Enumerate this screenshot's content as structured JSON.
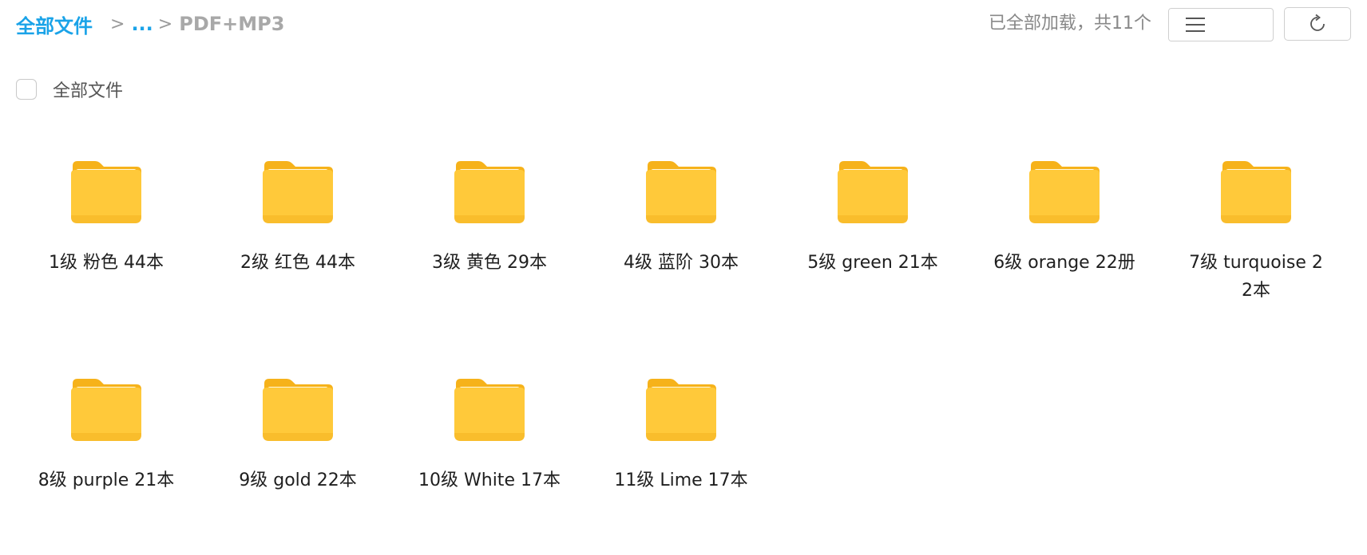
{
  "breadcrumb": {
    "root": "全部文件",
    "sep": ">",
    "ellipsis": "...",
    "current": "PDF+MP3"
  },
  "status": {
    "text": "已全部加载，共11个"
  },
  "toolbar": {
    "list_view_icon": "list-icon",
    "grid_view_icon": "grid-icon",
    "refresh_icon": "refresh-icon",
    "active_view": "grid"
  },
  "select_all": {
    "label": "全部文件"
  },
  "folders": [
    {
      "name": "1级 粉色 44本"
    },
    {
      "name": "2级 红色 44本"
    },
    {
      "name": "3级 黄色 29本"
    },
    {
      "name": "4级 蓝阶 30本"
    },
    {
      "name": "5级 green 21本"
    },
    {
      "name": "6级 orange 22册"
    },
    {
      "name": "7级 turquoise 22本"
    },
    {
      "name": "8级 purple 21本"
    },
    {
      "name": "9级 gold 22本"
    },
    {
      "name": "10级 White 17本"
    },
    {
      "name": "11级 Lime 17本"
    }
  ],
  "colors": {
    "accent": "#1aa3e8",
    "folder_front": "#ffc93a",
    "folder_back": "#f6b21a"
  }
}
